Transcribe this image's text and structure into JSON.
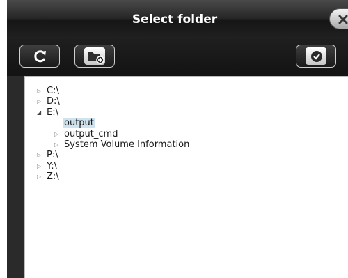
{
  "dialog": {
    "title": "Select folder"
  },
  "toolbar": {
    "refresh_icon": "refresh-icon",
    "new_folder_icon": "new-folder-icon",
    "confirm_icon": "checkmark-icon"
  },
  "tree": {
    "nodes": [
      {
        "label": "C:\\",
        "expanded": false
      },
      {
        "label": "D:\\",
        "expanded": false
      },
      {
        "label": "E:\\",
        "expanded": true
      },
      {
        "label": "output",
        "selected": true
      },
      {
        "label": "output_cmd",
        "expanded": false
      },
      {
        "label": "System Volume Information",
        "expanded": false
      },
      {
        "label": "P:\\",
        "expanded": false
      },
      {
        "label": "Y:\\",
        "expanded": false
      },
      {
        "label": "Z:\\",
        "expanded": false
      }
    ]
  },
  "colors": {
    "selection": "#cfe3ee",
    "titlebar": "#262626",
    "toolbar": "#171717"
  }
}
